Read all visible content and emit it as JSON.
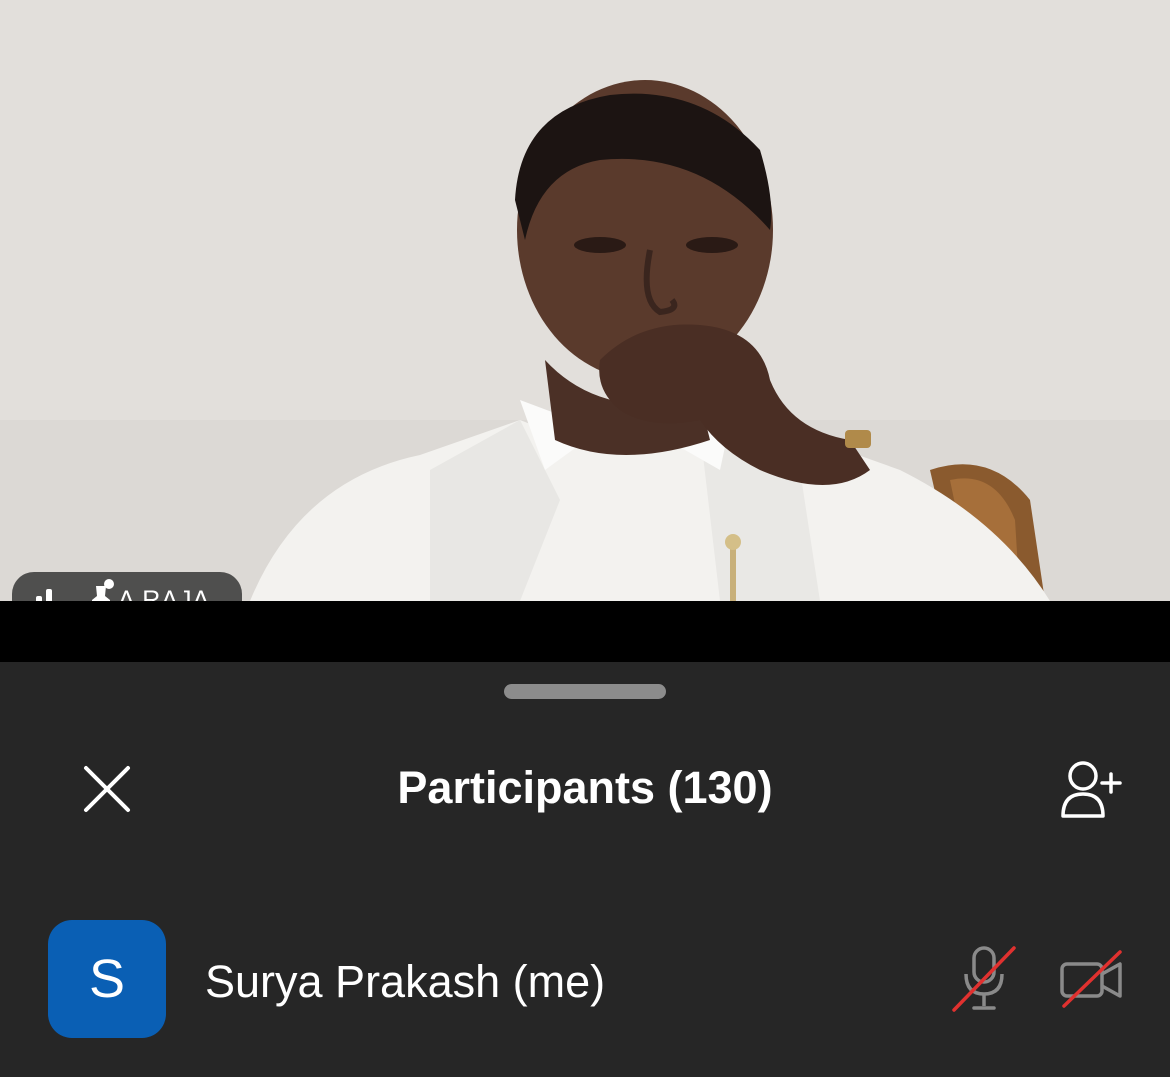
{
  "video": {
    "participant_name": "A RAJA"
  },
  "panel": {
    "title": "Participants (130)"
  },
  "participants": [
    {
      "initial": "S",
      "name": "Surya Prakash (me)",
      "avatar_color": "#0a5fb4",
      "mic": "muted",
      "camera": "off"
    }
  ],
  "colors": {
    "sheet_background": "#262626",
    "muted_slash": "#e0312f",
    "icon_gray": "#8a8a8a"
  },
  "icons": {
    "close": "close-icon",
    "add_participant": "add-person-icon",
    "signal": "signal-strength-icon",
    "pin": "pin-icon",
    "mic": "mic-muted-icon",
    "camera": "camera-off-icon"
  }
}
